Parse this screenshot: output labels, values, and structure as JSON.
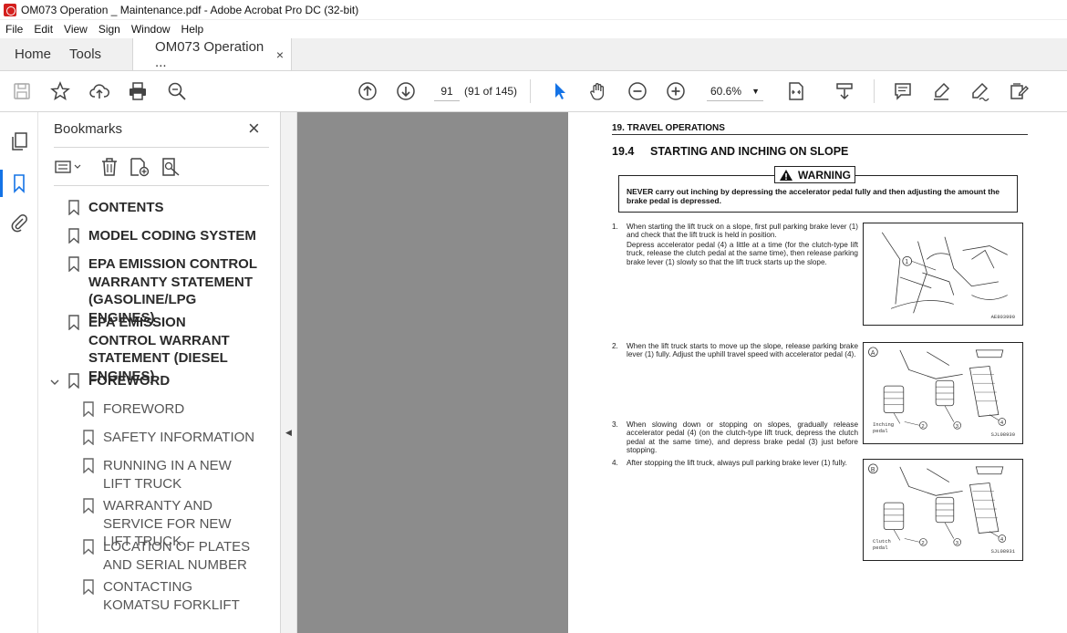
{
  "window": {
    "title": "OM073 Operation _ Maintenance.pdf - Adobe Acrobat Pro DC (32-bit)"
  },
  "menu": [
    "File",
    "Edit",
    "View",
    "Sign",
    "Window",
    "Help"
  ],
  "tabs": {
    "home": "Home",
    "tools": "Tools",
    "document": "OM073 Operation ...",
    "close": "×"
  },
  "toolbar": {
    "page_number": "91",
    "page_count": "(91 of 145)",
    "zoom": "60.6%",
    "icons": [
      "save-icon",
      "star-icon",
      "cloud-upload-icon",
      "print-icon",
      "search-icon",
      "prev-page-icon",
      "next-page-icon",
      "select-arrow-icon",
      "hand-icon",
      "zoom-out-icon",
      "zoom-in-icon",
      "page-fit-icon",
      "scroll-mode-icon",
      "comment-icon",
      "highlight-icon",
      "sign-icon",
      "edit-icon"
    ]
  },
  "sidebar": {
    "title": "Bookmarks",
    "close": "×",
    "bookmarks": [
      {
        "label": "CONTENTS"
      },
      {
        "label": "MODEL CODING SYSTEM"
      },
      {
        "label": "EPA EMISSION CONTROL WARRANTY STATEMENT (GASOLINE/LPG ENGINES)"
      },
      {
        "label": "EPA EMISSION CONTROL WARRANT STATEMENT (DIESEL ENGINES)"
      },
      {
        "label": "FOREWORD",
        "expanded": true
      }
    ],
    "children": [
      {
        "label": "FOREWORD"
      },
      {
        "label": "SAFETY INFORMATION"
      },
      {
        "label": "RUNNING IN A NEW LIFT TRUCK"
      },
      {
        "label": "WARRANTY AND SERVICE FOR NEW LIFT TRUCK"
      },
      {
        "label": "LOCATION OF PLATES AND SERIAL NUMBER"
      },
      {
        "label": "CONTACTING KOMATSU FORKLIFT"
      }
    ]
  },
  "document": {
    "section": "19. TRAVEL OPERATIONS",
    "sub_number": "19.4",
    "sub_title": "STARTING AND INCHING ON SLOPE",
    "warning_label": "WARNING",
    "warning_text": "NEVER carry out inching by depressing the accelerator pedal fully and then adjusting the amount the brake pedal is depressed.",
    "steps": [
      {
        "num": "1.",
        "text": "When starting the lift truck on a slope, first pull parking brake lever (1) and check that the lift truck is held in position.",
        "text2": "Depress accelerator pedal (4) a little at a time (for the clutch-type lift truck, release the clutch pedal at the same time), then release parking brake lever (1) slowly so that the lift truck starts up the slope."
      },
      {
        "num": "2.",
        "text": "When the lift truck starts to move up the slope, release parking brake lever (1) fully. Adjust the uphill travel speed with accelerator pedal (4)."
      },
      {
        "num": "3.",
        "text": "When slowing down or stopping on slopes, gradually release accelerator pedal (4) (on the clutch-type lift truck, depress the clutch pedal at the same time), and depress brake pedal (3) just before stopping."
      },
      {
        "num": "4.",
        "text": "After stopping the lift truck, always pull parking brake lever (1) fully."
      }
    ],
    "figures": [
      {
        "code": "AE803990",
        "marks": [
          "1"
        ]
      },
      {
        "code": "SJL08930",
        "panel": "A",
        "pedal": "Inching\npedal",
        "marks": [
          "1",
          "2",
          "3",
          "4"
        ]
      },
      {
        "code": "SJL08931",
        "panel": "B",
        "pedal": "Clutch\npedal",
        "marks": [
          "1",
          "2",
          "3",
          "4"
        ]
      }
    ]
  }
}
